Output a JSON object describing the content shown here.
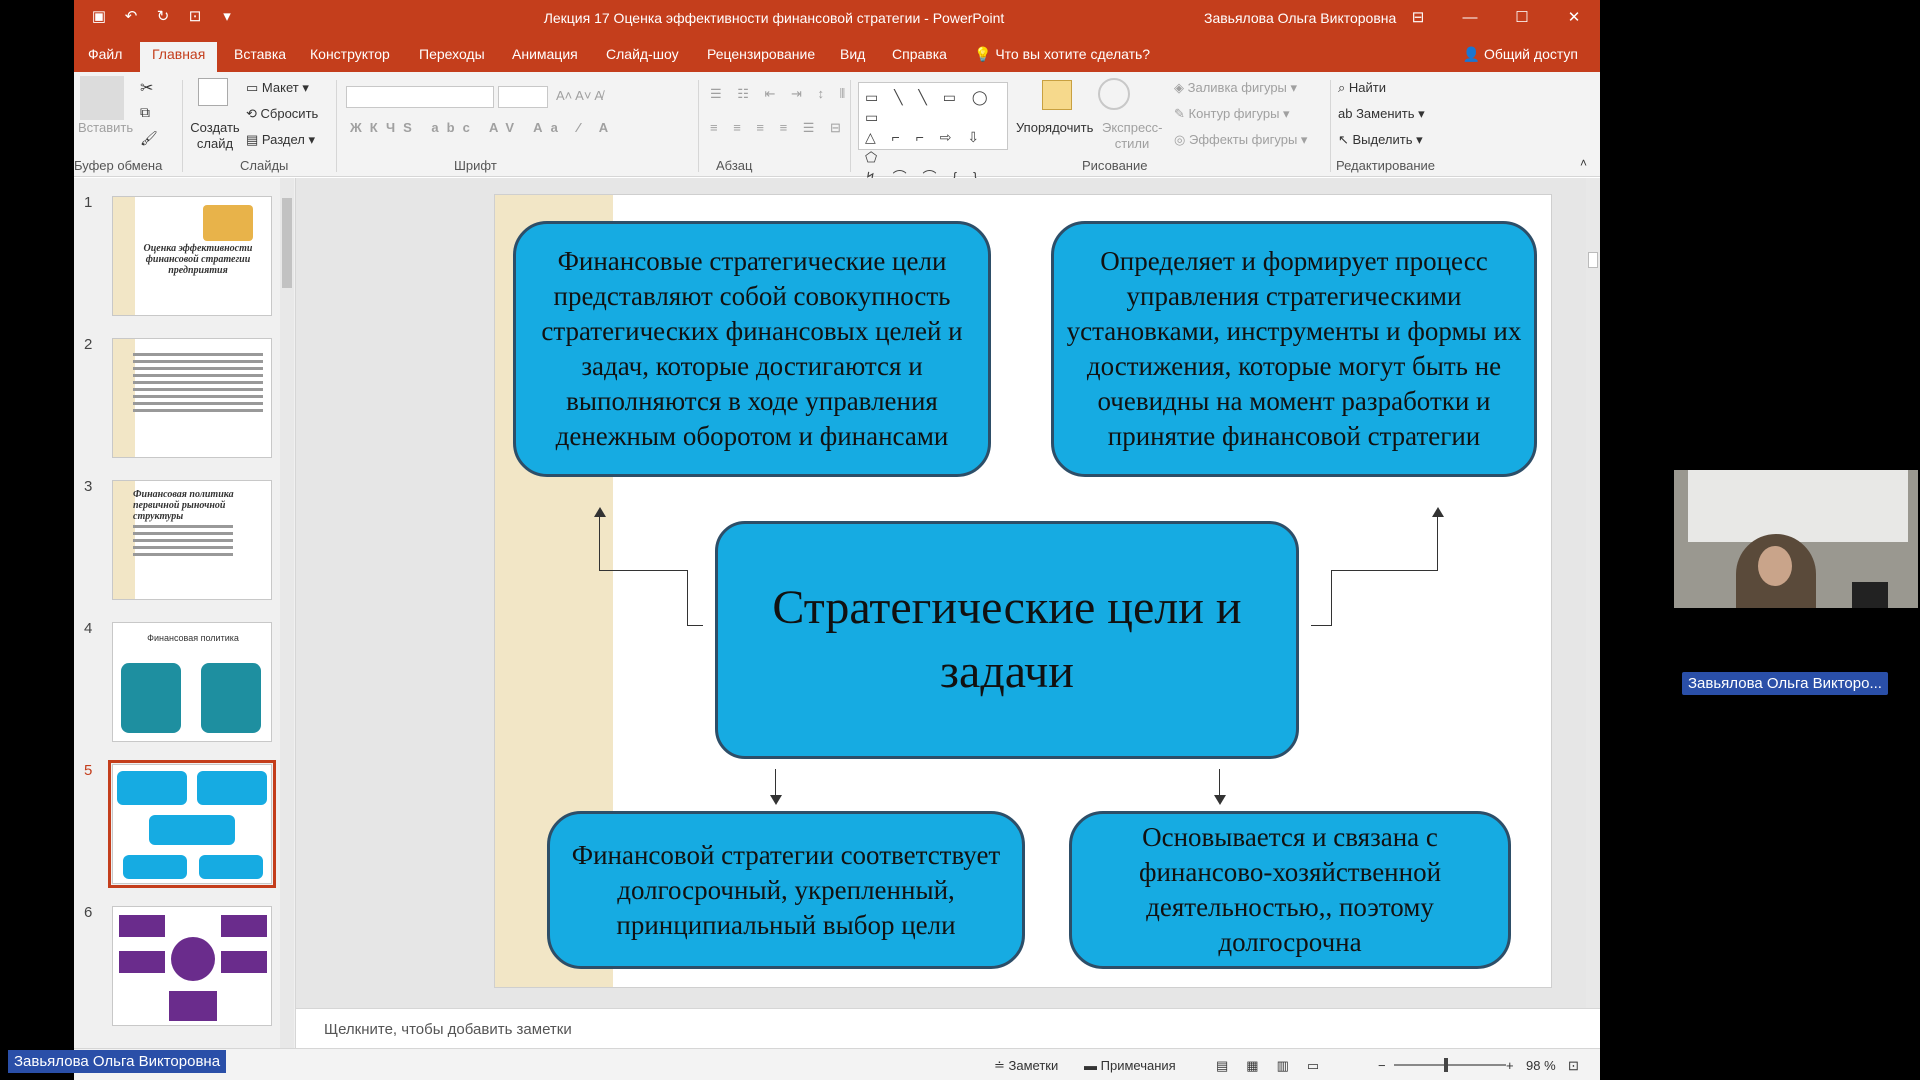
{
  "titlebar": {
    "doc_title": "Лекция 17 Оценка эффективности финансовой стратегии  -  PowerPoint",
    "user": "Завьялова Ольга Викторовна"
  },
  "tabs": {
    "file": "Файл",
    "home": "Главная",
    "insert": "Вставка",
    "design": "Конструктор",
    "transitions": "Переходы",
    "animations": "Анимация",
    "slideshow": "Слайд-шоу",
    "review": "Рецензирование",
    "view": "Вид",
    "help": "Справка",
    "tellme": "Что вы хотите сделать?",
    "share": "Общий доступ"
  },
  "ribbon": {
    "paste": "Вставить",
    "new_slide": "Создать слайд",
    "layout": "Макет",
    "reset": "Сбросить",
    "section": "Раздел",
    "arrange": "Упорядочить",
    "quick_styles": "Экспресс-стили",
    "shape_fill": "Заливка фигуры",
    "shape_outline": "Контур фигуры",
    "shape_effects": "Эффекты фигуры",
    "find": "Найти",
    "replace": "Заменить",
    "select": "Выделить",
    "groups": {
      "clipboard": "Буфер обмена",
      "slides": "Слайды",
      "font": "Шрифт",
      "paragraph": "Абзац",
      "drawing": "Рисование",
      "editing": "Редактирование"
    }
  },
  "thumbnails": {
    "numbers": [
      "1",
      "2",
      "3",
      "4",
      "5",
      "6"
    ],
    "slide1_title": "Оценка эффективности финансовой стратегии предприятия",
    "slide3_title": "Финансовая политика первичной рыночной структуры",
    "slide4_title": "Финансовая политика"
  },
  "slide": {
    "top_left": "Финансовые стратегические цели представляют собой совокупность стратегических финансовых целей и задач, которые достигаются и выполняются в ходе управления денежным оборотом и финансами",
    "top_right": "Определяет и формирует процесс управления стратегическими установками, инструменты и формы их достижения, которые могут быть не очевидны на момент разработки и принятие финансовой стратегии",
    "center": "Стратегические цели и задачи",
    "bottom_left": "Финансовой стратегии соответствует долгосрочный, укрепленный, принципиальный выбор цели",
    "bottom_right": "Основывается и связана с финансово-хозяйственной деятельностью,, поэтому долгосрочна"
  },
  "notes_placeholder": "Щелкните, чтобы добавить заметки",
  "statusbar": {
    "notes": "Заметки",
    "comments": "Примечания",
    "zoom": "98 %"
  },
  "participants": {
    "presenter_tag": "Завьялова Ольга Викторовна",
    "video_tag": "Завьялова Ольга Викторо..."
  }
}
